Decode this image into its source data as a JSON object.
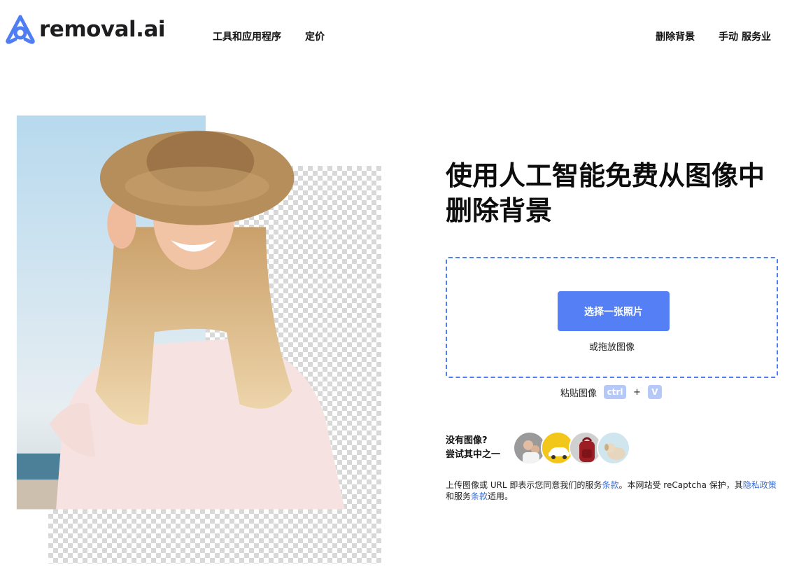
{
  "brand": {
    "name": "removal.ai",
    "accent": "#5580f5"
  },
  "nav": {
    "left": [
      "工具和应用程序",
      "定价"
    ],
    "right": [
      "删除背景",
      "手动 服务业"
    ]
  },
  "hero": {
    "title_line1": "使用人工智能免费从图像中",
    "title_line2": "删除背景"
  },
  "upload": {
    "button_label": "选择一张照片",
    "drop_label": "或拖放图像",
    "paste_label": "粘贴图像",
    "key_ctrl": "ctrl",
    "key_plus": "+",
    "key_v": "V"
  },
  "samples": {
    "line1": "没有图像?",
    "line2": "尝试其中之一",
    "icons": [
      "family-photo-icon",
      "yellow-car-icon",
      "red-backpack-icon",
      "puppy-icon"
    ]
  },
  "terms": {
    "part1": "上传图像或 URL 即表示您同意我们的服务",
    "link1": "条款",
    "part2": "。本网站受 reCaptcha 保护，其",
    "link2": "隐私政策",
    "part3": "和服务",
    "link3": "条款",
    "part4": "适用。"
  }
}
